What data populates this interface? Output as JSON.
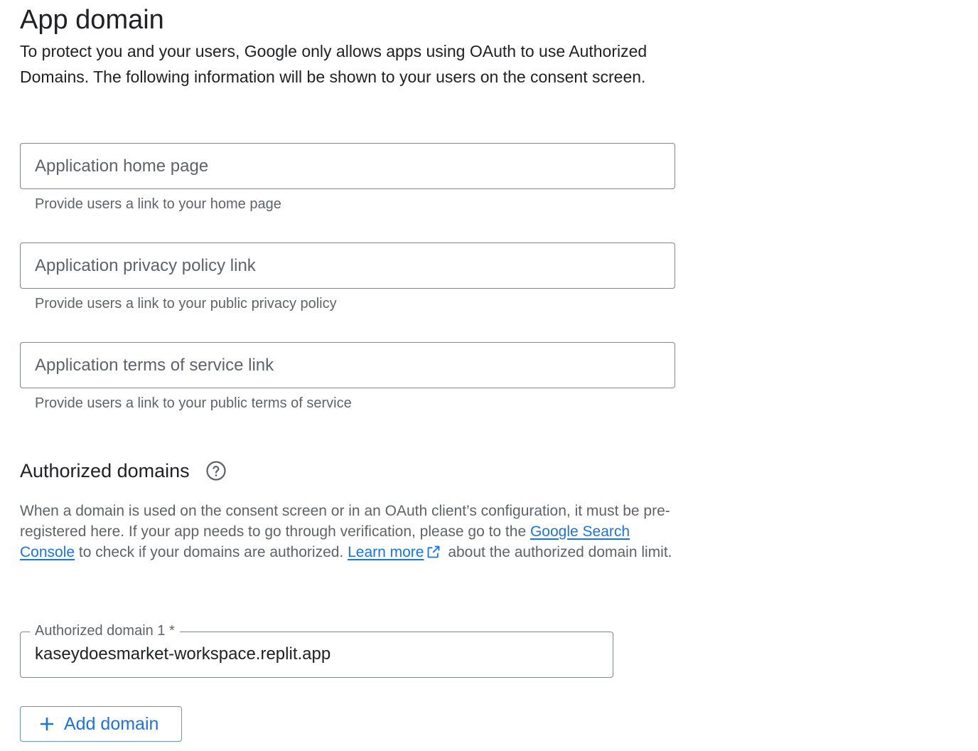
{
  "app_domain": {
    "title": "App domain",
    "description": "To protect you and your users, Google only allows apps using OAuth to use Authorized Domains. The following information will be shown to your users on the consent screen."
  },
  "fields": [
    {
      "placeholder": "Application home page",
      "value": "",
      "hint": "Provide users a link to your home page"
    },
    {
      "placeholder": "Application privacy policy link",
      "value": "",
      "hint": "Provide users a link to your public privacy policy"
    },
    {
      "placeholder": "Application terms of service link",
      "value": "",
      "hint": "Provide users a link to your public terms of service"
    }
  ],
  "authorized_domains": {
    "title": "Authorized domains",
    "help_icon": "help-circle-icon",
    "desc_part1": "When a domain is used on the consent screen or in an OAuth client’s configuration, it must be pre-registered here. If your app needs to go through verification, please go to the ",
    "link_search_console": "Google Search Console",
    "desc_part2": " to check if your domains are authorized. ",
    "link_learn_more": "Learn more",
    "external_icon": "open-in-new-icon",
    "desc_part3": " about the authorized domain limit.",
    "domain_field": {
      "label": "Authorized domain 1 *",
      "value": "kaseydoesmarket-workspace.replit.app"
    },
    "add_button_label": "Add domain",
    "add_icon": "plus-icon"
  },
  "colors": {
    "link": "#1a73e8",
    "text_primary": "#202124",
    "text_secondary": "#5f6368",
    "border": "#80868b"
  }
}
